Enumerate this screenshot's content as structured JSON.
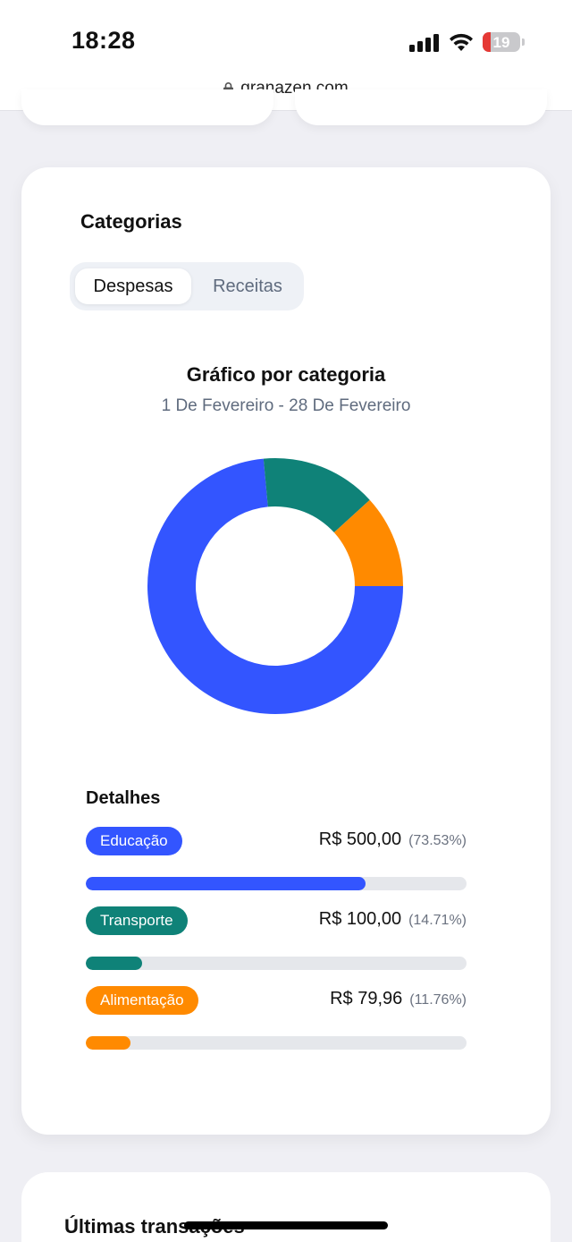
{
  "status": {
    "time": "18:28",
    "battery": "19",
    "url": "granazen.com"
  },
  "categories_card": {
    "title": "Categorias",
    "tabs": [
      {
        "label": "Despesas",
        "active": true
      },
      {
        "label": "Receitas",
        "active": false
      }
    ],
    "chart_title": "Gráfico por categoria",
    "date_range": "1 De Fevereiro - 28 De Fevereiro",
    "details_title": "Detalhes",
    "items": [
      {
        "label": "Educação",
        "amount": "R$ 500,00",
        "percent_text": "(73.53%)",
        "percent": 73.53,
        "color": "#3355ff"
      },
      {
        "label": "Transporte",
        "amount": "R$ 100,00",
        "percent_text": "(14.71%)",
        "percent": 14.71,
        "color": "#0f8278"
      },
      {
        "label": "Alimentação",
        "amount": "R$ 79,96",
        "percent_text": "(11.76%)",
        "percent": 11.76,
        "color": "#ff8a00"
      }
    ]
  },
  "chart_data": {
    "type": "pie",
    "title": "Gráfico por categoria",
    "categories": [
      "Educação",
      "Transporte",
      "Alimentação"
    ],
    "values": [
      73.53,
      14.71,
      11.76
    ],
    "colors": [
      "#3355ff",
      "#0f8278",
      "#ff8a00"
    ],
    "donut": true
  },
  "transactions_card": {
    "title": "Últimas transações"
  }
}
